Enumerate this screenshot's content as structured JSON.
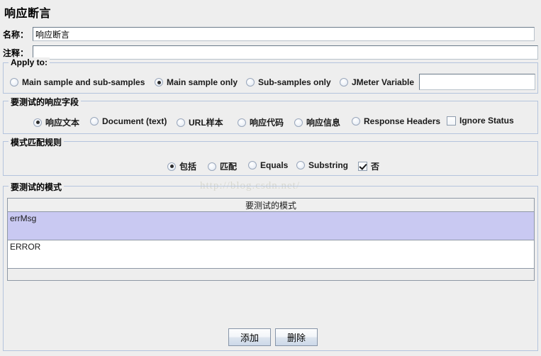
{
  "panel": {
    "title": "响应断言"
  },
  "fields": {
    "name_label": "名称：",
    "name_value": "响应断言",
    "name_placeholder": "",
    "comment_label": "注释：",
    "comment_value": "",
    "comment_placeholder": ""
  },
  "apply_to": {
    "title": "Apply to:",
    "options": [
      {
        "label": "Main sample and sub-samples",
        "selected": false
      },
      {
        "label": "Main sample only",
        "selected": true
      },
      {
        "label": "Sub-samples only",
        "selected": false
      },
      {
        "label": "JMeter Variable",
        "selected": false
      }
    ],
    "variable_value": "",
    "variable_placeholder": ""
  },
  "response_field": {
    "title": "要测试的响应字段",
    "options": [
      {
        "label": "响应文本",
        "selected": true
      },
      {
        "label": "Document (text)",
        "selected": false
      },
      {
        "label": "URL样本",
        "selected": false
      },
      {
        "label": "响应代码",
        "selected": false
      },
      {
        "label": "响应信息",
        "selected": false
      },
      {
        "label": "Response Headers",
        "selected": false
      }
    ],
    "ignore_status": {
      "label": "Ignore Status",
      "checked": false
    }
  },
  "pattern_rules": {
    "title": "模式匹配规则",
    "options": [
      {
        "label": "包括",
        "selected": true
      },
      {
        "label": "匹配",
        "selected": false
      },
      {
        "label": "Equals",
        "selected": false
      },
      {
        "label": "Substring",
        "selected": false
      }
    ],
    "not_checkbox": {
      "label": "否",
      "checked": true
    }
  },
  "patterns": {
    "title": "要测试的模式",
    "column_header": "要测试的模式",
    "rows": [
      {
        "value": "errMsg",
        "selected": true
      },
      {
        "value": "ERROR",
        "selected": false
      }
    ]
  },
  "buttons": {
    "add": "添加",
    "delete": "删除"
  },
  "watermark": {
    "text": "http://blog.csdn.net/"
  },
  "colors": {
    "background": "#eeeeee",
    "selection": "#c9c9f2",
    "group_border": "#b4c4dd",
    "table_border": "#8e98a5"
  }
}
